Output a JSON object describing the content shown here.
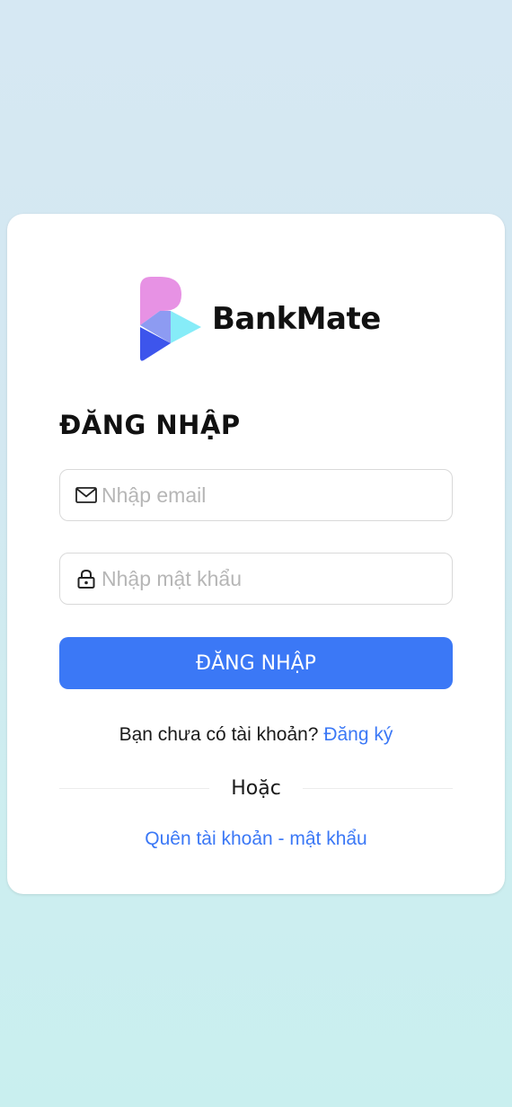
{
  "brand": {
    "name": "BankMate",
    "colors": {
      "pink": "#e792e4",
      "periwinkle": "#8d9bf2",
      "cyan": "#86ecf8",
      "blue": "#3d55ec"
    }
  },
  "login": {
    "title": "ĐĂNG NHẬP",
    "email_placeholder": "Nhập email",
    "password_placeholder": "Nhập mật khẩu",
    "submit_label": "ĐĂNG NHẬP",
    "no_account_text": "Bạn chưa có tài khoản? ",
    "register_link": "Đăng ký",
    "or_label": "Hoặc",
    "forgot_link": "Quên tài khoản - mật khẩu"
  },
  "icons": {
    "email": "mail-icon",
    "password": "lock-icon"
  },
  "colors": {
    "accent": "#3b78f6"
  }
}
